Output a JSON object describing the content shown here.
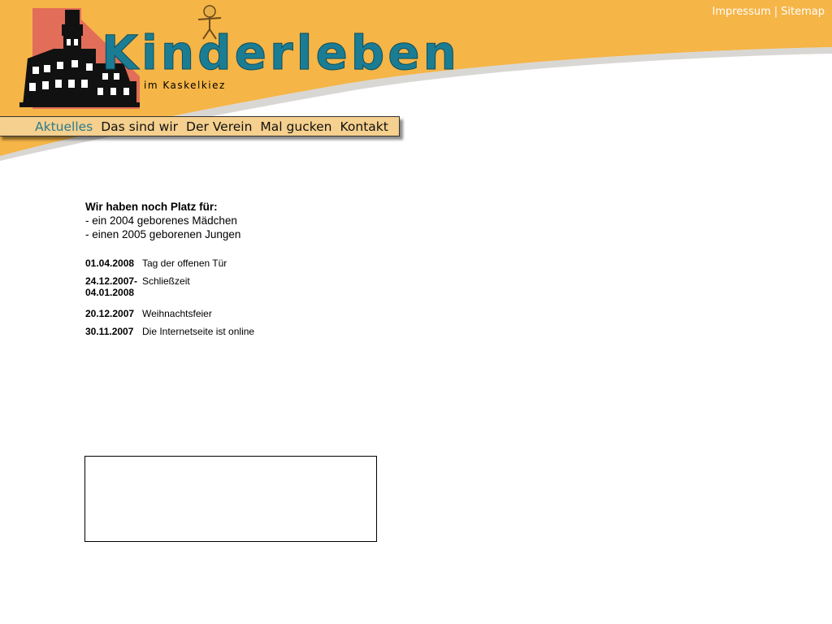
{
  "header": {
    "top_links": {
      "impressum": "Impressum",
      "separator": "|",
      "sitemap": "Sitemap"
    },
    "logo": {
      "wordmark": "Kinderleben",
      "subtitle": "im Kaskelkiez"
    },
    "colors": {
      "orange": "#f5b547",
      "nav_bg": "#f5d08e",
      "accent": "#2b7b8f"
    }
  },
  "nav": {
    "items": [
      {
        "label": "Aktuelles",
        "active": true
      },
      {
        "label": "Das sind wir"
      },
      {
        "label": "Der Verein"
      },
      {
        "label": "Mal gucken"
      },
      {
        "label": "Kontakt"
      }
    ]
  },
  "main": {
    "notice": {
      "title": "Wir haben noch Platz für:",
      "lines": [
        "- ein 2004 geborenes Mädchen",
        "- einen 2005 geborenen Jungen"
      ]
    },
    "news": [
      {
        "date": "01.04.2008",
        "text": "Tag der offenen Tür"
      },
      {
        "date": "24.12.2007-\n04.01.2008",
        "text": "Schließzeit"
      },
      {
        "date": "20.12.2007",
        "text": "Weihnachtsfeier"
      },
      {
        "date": "30.11.2007",
        "text": "Die Internetseite ist online"
      }
    ]
  }
}
